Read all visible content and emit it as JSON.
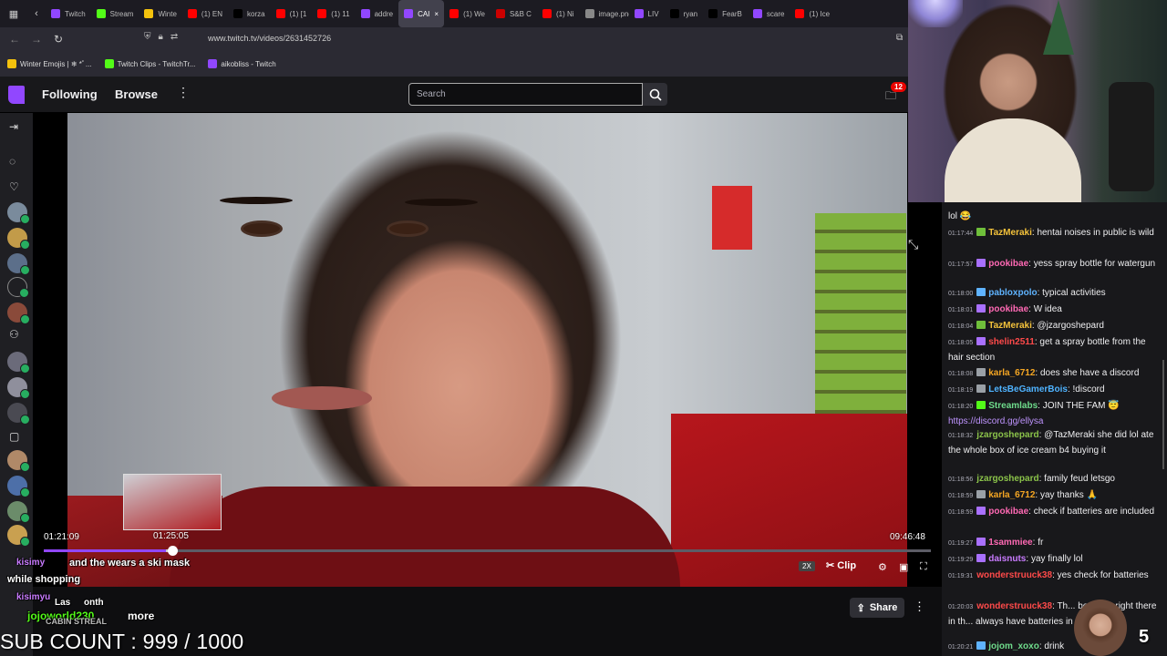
{
  "browser": {
    "tabs": [
      {
        "label": "Twitch",
        "color": "#9147ff"
      },
      {
        "label": "Stream",
        "color": "#53fc18"
      },
      {
        "label": "Winte",
        "color": "#f4c20d"
      },
      {
        "label": "(1) EN",
        "color": "#ff0000"
      },
      {
        "label": "korza",
        "color": "#000000"
      },
      {
        "label": "(1) [1",
        "color": "#ff0000"
      },
      {
        "label": "(1) 11",
        "color": "#ff0000"
      },
      {
        "label": "addre",
        "color": "#9147ff"
      },
      {
        "label": "CAI",
        "color": "#9147ff"
      },
      {
        "label": "(1) We",
        "color": "#ff0000"
      },
      {
        "label": "S&B C",
        "color": "#cc0000"
      },
      {
        "label": "(1) Ni",
        "color": "#ff0000"
      },
      {
        "label": "image.png",
        "color": "#888888"
      },
      {
        "label": "LIV",
        "color": "#9147ff"
      },
      {
        "label": "ryan",
        "color": "#000000"
      },
      {
        "label": "FearB",
        "color": "#000000"
      },
      {
        "label": "scare",
        "color": "#9147ff"
      },
      {
        "label": "(1) Ice",
        "color": "#ff0000"
      }
    ],
    "url": "www.twitch.tv/videos/2631452726",
    "bookmarks": [
      "Winter Emojis | ❄ *ﾟ...",
      "Twitch Clips - TwitchTr...",
      "aikobliss - Twitch"
    ]
  },
  "nav": {
    "following": "Following",
    "browse": "Browse",
    "search_placeholder": "Search",
    "inbox_count": "12"
  },
  "player": {
    "hover_time": "01:25:05",
    "current_time": "01:21:09",
    "duration": "09:46:48",
    "progress_fraction": 0.138,
    "hover_fraction": 0.145,
    "speed_label": "2X",
    "clip_label": "Clip",
    "share_label": "Share"
  },
  "overlay": {
    "line1_user": "kisimy",
    "line1_text": "and the wears a ski mask",
    "line2_text": "while shopping",
    "line3_user": "kisimyu",
    "line4_text": "Las",
    "line4_tail": "onth",
    "line5_user": "jojoworld230",
    "line5_text": "more",
    "line6_text": "CABIN STREAL",
    "sub_count": "SUB COUNT : 999 / 1000"
  },
  "chat": {
    "messages": [
      {
        "ts": "",
        "user": "",
        "color": "#ff4a4a",
        "badge": "",
        "text": "lol 😂",
        "cont": true
      },
      {
        "ts": "01:17:44",
        "user": "TazMeraki",
        "color": "#f5c33b",
        "badge": "#6fbf3b",
        "text": "hentai noises in public is wild"
      },
      {
        "ts": "01:17:57",
        "user": "pookibae",
        "color": "#ff69b4",
        "badge": "#a970ff",
        "text": "yess spray bottle for watergun"
      },
      {
        "ts": "01:18:00",
        "user": "pabloxpolo",
        "color": "#5fb3ff",
        "badge": "#5fb3ff",
        "text": "typical activities"
      },
      {
        "ts": "01:18:01",
        "user": "pookibae",
        "color": "#ff69b4",
        "badge": "#a970ff",
        "text": "W idea"
      },
      {
        "ts": "01:18:04",
        "user": "TazMeraki",
        "color": "#f5c33b",
        "badge": "#6fbf3b",
        "text": "@jzargoshepard"
      },
      {
        "ts": "01:18:05",
        "user": "shelin2511",
        "color": "#ff4a4a",
        "badge": "#a970ff",
        "text": "get a spray bottle from the hair section"
      },
      {
        "ts": "01:18:08",
        "user": "karla_6712",
        "color": "#f5a623",
        "badge": "#9aa0a6",
        "text": "does she have a discord"
      },
      {
        "ts": "01:18:19",
        "user": "LetsBeGamerBois",
        "color": "#4fb3ff",
        "badge": "#9aa0a6",
        "text": "!discord"
      },
      {
        "ts": "01:18:20",
        "user": "Streamlabs",
        "color": "#6fdc8c",
        "badge": "#53fc18",
        "text": "JOIN THE FAM 😇",
        "link": "https://discord.gg/ellysa"
      },
      {
        "ts": "01:18:32",
        "user": "jzargoshepard",
        "color": "#8bc34a",
        "badge": "",
        "text": "@TazMeraki she did lol ate the whole box of ice cream b4 buying it"
      },
      {
        "ts": "01:18:56",
        "user": "jzargoshepard",
        "color": "#8bc34a",
        "badge": "",
        "text": "family feud letsgo"
      },
      {
        "ts": "01:18:59",
        "user": "karla_6712",
        "color": "#f5a623",
        "badge": "#9aa0a6",
        "text": "yay thanks 🙏"
      },
      {
        "ts": "01:18:59",
        "user": "pookibae",
        "color": "#ff69b4",
        "badge": "#a970ff",
        "text": "check if batteries are included"
      },
      {
        "ts": "01:19:27",
        "user": "1sammiee",
        "color": "#ff69b4",
        "badge": "#a970ff",
        "text": "fr"
      },
      {
        "ts": "01:19:29",
        "user": "daisnuts",
        "color": "#c97bff",
        "badge": "#a970ff",
        "text": "yay finally lol"
      },
      {
        "ts": "01:19:31",
        "user": "wonderstruuck38",
        "color": "#ff4a4a",
        "badge": "",
        "text": "yes check for batteries"
      },
      {
        "ts": "01:20:03",
        "user": "wonderstruuck38",
        "color": "#ff4a4a",
        "badge": "",
        "text": "Th... be some right there in th... always have batteries in the t..."
      },
      {
        "ts": "01:20:21",
        "user": "jojom_xoxo",
        "color": "#6fdc8c",
        "badge": "#5fb3ff",
        "text": "drink"
      }
    ],
    "cam_number": "5"
  }
}
